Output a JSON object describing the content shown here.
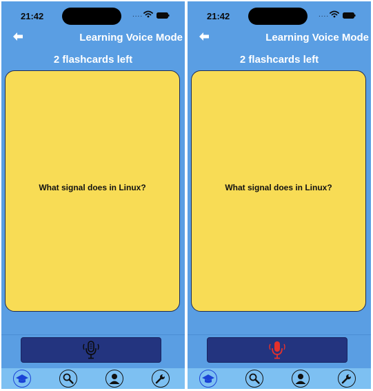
{
  "screens": [
    {
      "status_bar": {
        "time": "21:42",
        "signal_dots": "....",
        "icons": [
          "wifi-icon",
          "battery-icon"
        ]
      },
      "nav": {
        "title": "Learning Voice Mode",
        "back_icon": "back-arrow-icon"
      },
      "remaining_text": "2 flashcards left",
      "card": {
        "question": "What signal  does  in Linux?",
        "color": "#f8dc55"
      },
      "mic": {
        "icon": "microphone-icon",
        "state": "idle",
        "icon_color": "#0b0b0b"
      },
      "tabs": [
        {
          "icon": "graduation-cap-icon",
          "active": true
        },
        {
          "icon": "search-icon",
          "active": false
        },
        {
          "icon": "user-icon",
          "active": false
        },
        {
          "icon": "wrench-icon",
          "active": false
        }
      ]
    },
    {
      "status_bar": {
        "time": "21:42",
        "signal_dots": "....",
        "icons": [
          "wifi-icon",
          "battery-icon"
        ]
      },
      "nav": {
        "title": "Learning Voice Mode",
        "back_icon": "back-arrow-icon"
      },
      "remaining_text": "2 flashcards left",
      "card": {
        "question": "What signal  does  in Linux?",
        "color": "#f8dc55"
      },
      "mic": {
        "icon": "microphone-icon",
        "state": "recording",
        "icon_color": "#e5312b"
      },
      "tabs": [
        {
          "icon": "graduation-cap-icon",
          "active": true
        },
        {
          "icon": "search-icon",
          "active": false
        },
        {
          "icon": "user-icon",
          "active": false
        },
        {
          "icon": "wrench-icon",
          "active": false
        }
      ]
    }
  ],
  "colors": {
    "background": "#5a9ee3",
    "tab_bar": "#7dc0f2",
    "mic_button": "#23347f",
    "card": "#f8dc55",
    "active_tab": "#1a43d6"
  }
}
